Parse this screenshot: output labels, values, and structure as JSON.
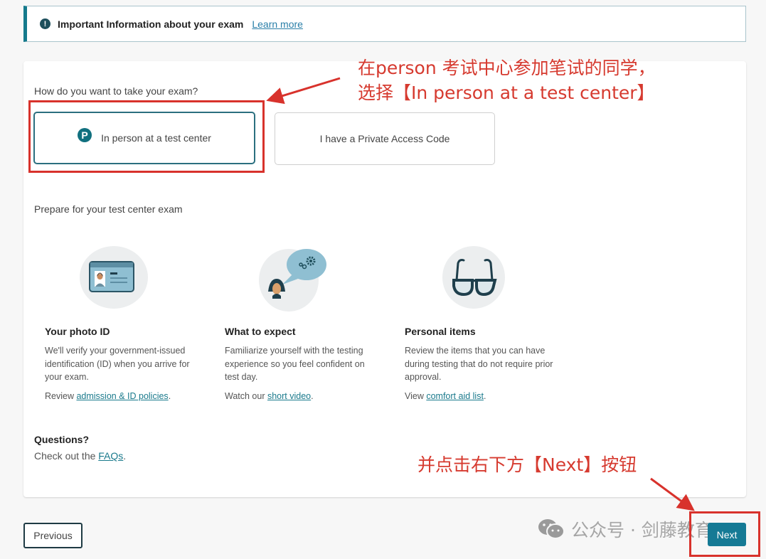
{
  "alert": {
    "icon": "info-circle-icon",
    "text": "Important Information about your exam",
    "link": "Learn more"
  },
  "exam_mode": {
    "question": "How do you want to take your exam?",
    "options": [
      {
        "label": "In person at a test center",
        "icon": "pearson-logo-icon",
        "selected": true
      },
      {
        "label": "I have a Private Access Code",
        "selected": false
      }
    ]
  },
  "prepare": {
    "heading": "Prepare for your test center exam",
    "items": [
      {
        "title": "Your photo ID",
        "description": "We'll verify your government-issued identification (ID) when you arrive for your exam.",
        "link_prefix": "Review ",
        "link_text": "admission & ID policies",
        "link_suffix": ".",
        "icon": "id-card-icon"
      },
      {
        "title": "What to expect",
        "description": "Familiarize yourself with the testing experience so you feel confident on test day.",
        "link_prefix": "Watch our ",
        "link_text": "short video",
        "link_suffix": ".",
        "icon": "person-thinking-icon"
      },
      {
        "title": "Personal items",
        "description": "Review the items that you can have during testing that do not require prior approval.",
        "link_prefix": "View ",
        "link_text": "comfort aid list",
        "link_suffix": ".",
        "icon": "glasses-icon"
      }
    ]
  },
  "questions": {
    "heading": "Questions?",
    "prefix": "Check out the ",
    "link": "FAQs",
    "suffix": "."
  },
  "nav": {
    "previous": "Previous",
    "next": "Next"
  },
  "annotations": {
    "top_line1": "在person 考试中心参加笔试的同学，",
    "top_line2": "选择【In person at a test center】",
    "bottom": "并点击右下方【Next】按钮",
    "watermark": "公众号 · 剑藤教育"
  },
  "colors": {
    "accent": "#157a8c",
    "annotation": "#d8322c"
  }
}
